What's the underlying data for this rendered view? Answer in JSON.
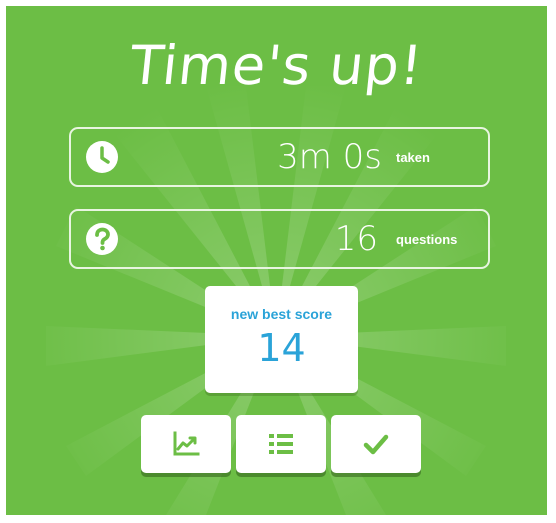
{
  "title": "Time's up!",
  "stats": [
    {
      "icon": "clock-icon",
      "value": "3m 0s",
      "label": "taken"
    },
    {
      "icon": "question-icon",
      "value": "16",
      "label": "questions"
    }
  ],
  "score_card": {
    "label": "new best score",
    "value": "14"
  },
  "buttons": [
    {
      "name": "stats-button",
      "icon": "chart-icon"
    },
    {
      "name": "list-button",
      "icon": "list-icon"
    },
    {
      "name": "done-button",
      "icon": "check-icon"
    }
  ],
  "colors": {
    "background": "#6cbe45",
    "score_text": "#2aa3d8",
    "button_icon": "#6cbe45",
    "text": "#ffffff"
  }
}
